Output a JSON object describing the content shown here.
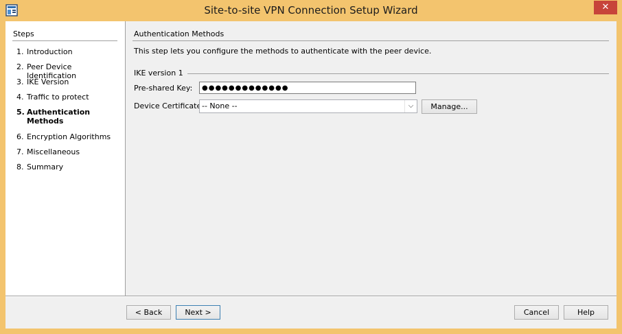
{
  "window": {
    "title": "Site-to-site VPN Connection Setup Wizard",
    "close_glyph": "✕",
    "accent_color": "#f3c46e"
  },
  "steps": {
    "header": "Steps",
    "items": [
      {
        "num": "1.",
        "label": "Introduction",
        "active": false
      },
      {
        "num": "2.",
        "label": "Peer Device Identification",
        "active": false
      },
      {
        "num": "3.",
        "label": "IKE Version",
        "active": false
      },
      {
        "num": "4.",
        "label": "Traffic to protect",
        "active": false
      },
      {
        "num": "5.",
        "label": "Authentication Methods",
        "active": true
      },
      {
        "num": "6.",
        "label": "Encryption Algorithms",
        "active": false
      },
      {
        "num": "7.",
        "label": "Miscellaneous",
        "active": false
      },
      {
        "num": "8.",
        "label": "Summary",
        "active": false
      }
    ]
  },
  "main": {
    "title": "Authentication Methods",
    "description": "This step lets you configure the methods to authenticate with the peer device.",
    "ike_group": "IKE version 1",
    "psk_label": "Pre-shared Key:",
    "psk_value": "●●●●●●●●●●●●●",
    "cert_label": "Device Certificate:",
    "cert_value": "-- None --",
    "manage_label": "Manage..."
  },
  "footer": {
    "back_label": "< Back",
    "next_label": "Next >",
    "cancel_label": "Cancel",
    "help_label": "Help"
  }
}
